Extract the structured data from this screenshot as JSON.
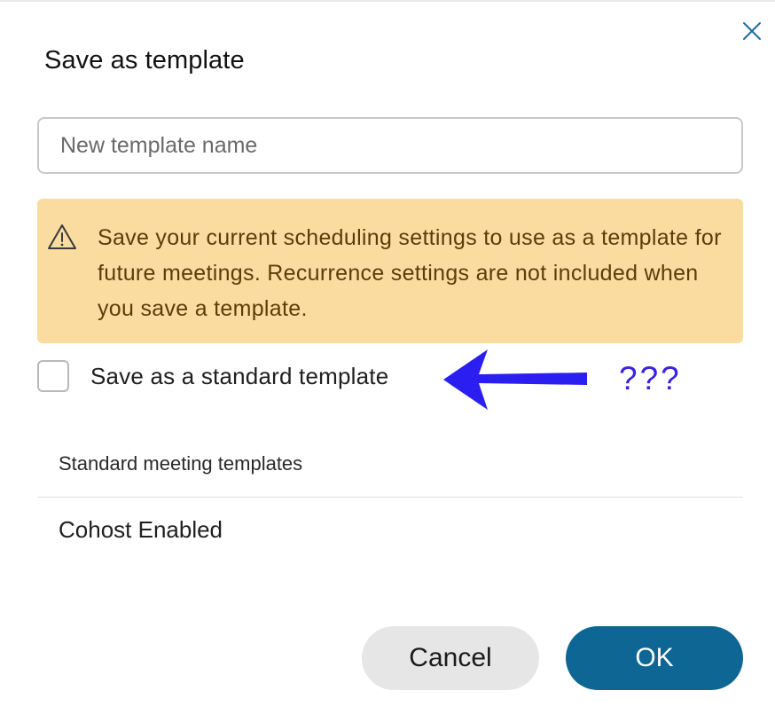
{
  "dialog": {
    "title": "Save as template",
    "close_icon": "close-icon"
  },
  "name_input": {
    "placeholder": "New template name",
    "value": ""
  },
  "warning": {
    "icon": "warning-triangle-icon",
    "text": "Save your current scheduling settings to use as a template for future meetings. Recurrence settings are not included when you save a template.",
    "background": "#fbdca0",
    "text_color": "#5c3d0a"
  },
  "standard_option": {
    "label": "Save as a standard template",
    "checked": false
  },
  "annotation": {
    "arrow_icon": "left-arrow-icon",
    "text": "???",
    "color": "#3a22e0"
  },
  "templates_section": {
    "header": "Standard meeting templates",
    "items": [
      {
        "label": "Cohost Enabled"
      }
    ]
  },
  "buttons": {
    "cancel_label": "Cancel",
    "ok_label": "OK",
    "ok_color": "#0d6694"
  }
}
